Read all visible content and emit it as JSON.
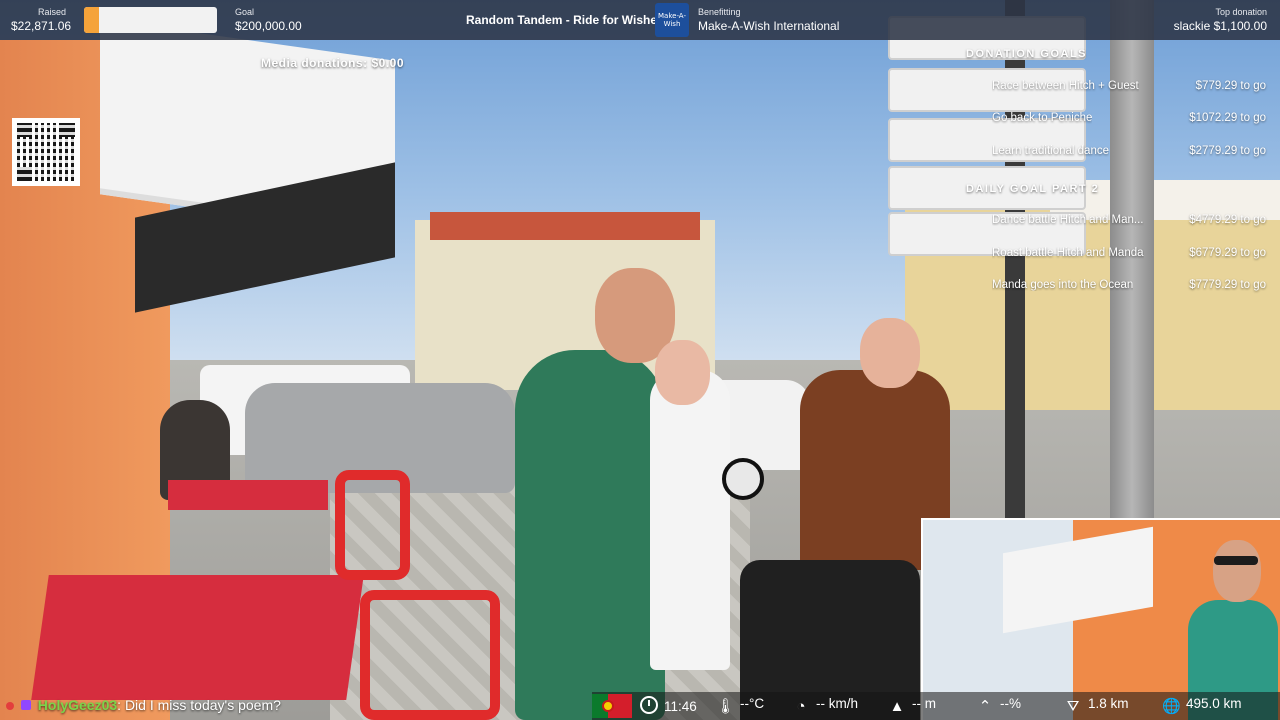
{
  "topbar": {
    "raised_label": "Raised",
    "raised_value": "$22,871.06",
    "progress_fraction": 0.114,
    "goal_label": "Goal",
    "goal_value": "$200,000.00",
    "stream_title": "Random Tandem - Ride for Wishes",
    "charity_logo_text": "Make-A-Wish",
    "benefitting_label": "Benefitting",
    "benefitting_value": "Make-A-Wish International",
    "top_donation_label": "Top donation",
    "top_donation_value": "slackie $1,100.00"
  },
  "media_donations": "Media donations: $0.00",
  "qr_icon": "qr-code-icon",
  "donation_goals": {
    "header": "DONATION GOALS",
    "items": [
      {
        "label": "Race between Hitch + Guest",
        "amount": "$779.29 to go"
      },
      {
        "label": "Go back to Peniche",
        "amount": "$1072.29 to go"
      },
      {
        "label": "Learn traditional dance",
        "amount": "$2779.29 to go"
      }
    ]
  },
  "daily_goals": {
    "header": "DAILY GOAL PART 2",
    "items": [
      {
        "label": "Dance battle Hitch and Man...",
        "amount": "$4779.29 to go"
      },
      {
        "label": "Roast battle Hitch and Manda",
        "amount": "$6779.29 to go"
      },
      {
        "label": "Manda goes into the Ocean",
        "amount": "$7779.29 to go"
      }
    ]
  },
  "chat": {
    "username": "HolyGeez03",
    "separator": ":",
    "message": "Did I miss today's poem?"
  },
  "telemetry": {
    "flag": "portugal-flag-icon",
    "time": "11:46",
    "temperature": "--°C",
    "speed": "-- km/h",
    "altitude": "-- m",
    "grade": "--%",
    "distance": "1.8 km",
    "total_distance": "495.0 km"
  },
  "colors": {
    "topbar_bg": "#2c3446",
    "progress_fill": "#f5a33a",
    "chat_username": "#7cd44a"
  }
}
